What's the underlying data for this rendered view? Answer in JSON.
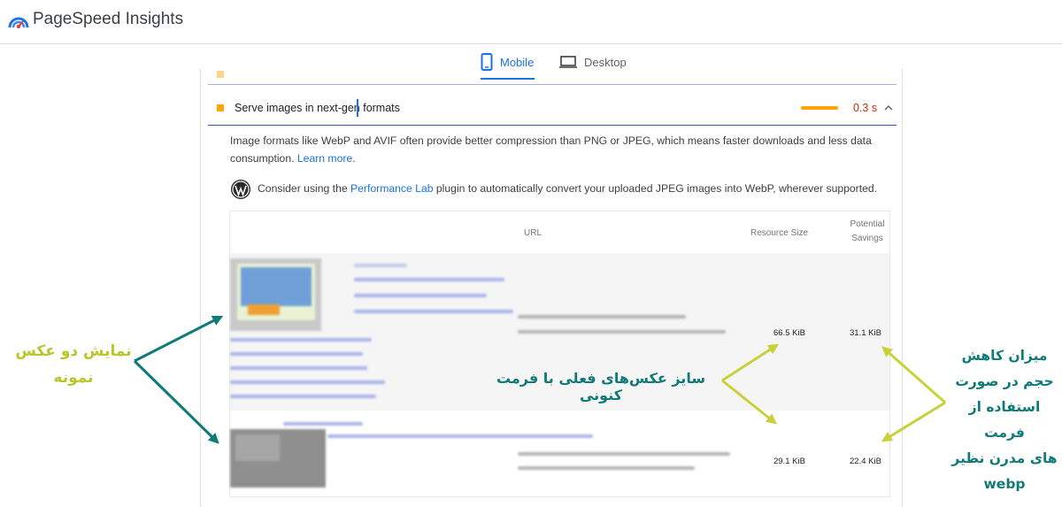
{
  "app": {
    "title": "PageSpeed Insights"
  },
  "tabs": [
    {
      "label": "Mobile",
      "active": true
    },
    {
      "label": "Desktop",
      "active": false
    }
  ],
  "audit": {
    "title_part1": "Serve images in next-gen",
    "title_part2": " formats",
    "savings": "0.3 s",
    "desc_text": "Image formats like WebP and AVIF often provide better compression than PNG or JPEG, which means faster downloads and less data consumption. ",
    "learn_more": "Learn more",
    "desc_end": ".",
    "wp_before": "Consider using the ",
    "wp_link": "Performance Lab",
    "wp_after": " plugin to automatically convert your uploaded JPEG images into WebP, wherever supported."
  },
  "table": {
    "col_url": "URL",
    "col_size": "Resource Size",
    "col_savings_1": "Potential",
    "col_savings_2": "Savings",
    "rows": [
      {
        "size": "66.5 KiB",
        "savings": "31.1 KiB"
      },
      {
        "size": "29.1 KiB",
        "savings": "22.4 KiB"
      }
    ]
  },
  "annotations": {
    "left_line1": "نمایش دو عکس",
    "left_line2": "نمونه",
    "middle": "سایز عکس‌های فعلی با فرمت کنونی",
    "right_line1": "میزان کاهش",
    "right_line2": "حجم در صورت",
    "right_line3": "استفاده از فرمت",
    "right_line4": "های مدرن نظیر",
    "right_line5": "webp"
  },
  "colors": {
    "accent": "#1a73e8",
    "warn": "#ffa400",
    "savings_text": "#c33300",
    "annotation_teal": "#0f7a78",
    "annotation_lime": "#b9c62a"
  }
}
